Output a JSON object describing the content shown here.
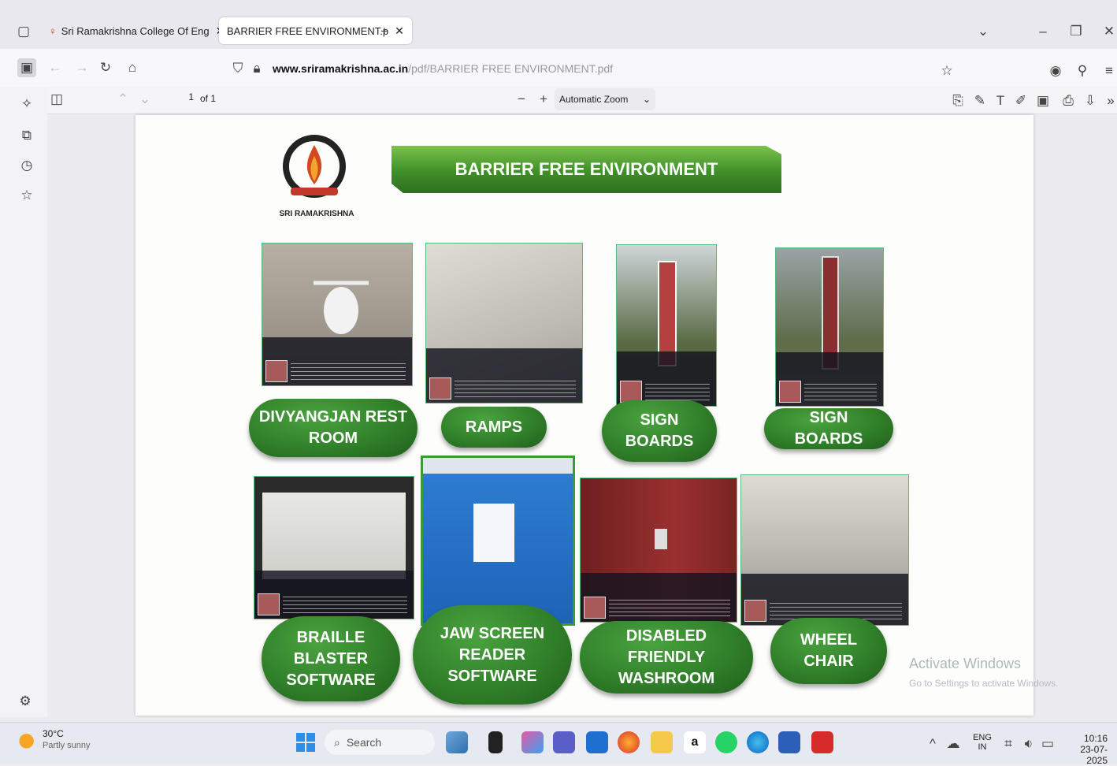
{
  "tabs": [
    {
      "label": "Sri Ramakrishna College Of Eng"
    },
    {
      "label": "BARRIER FREE ENVIRONMENT.p"
    }
  ],
  "address": {
    "domain": "www.sriramakrishna.ac.in",
    "path": "/pdf/BARRIER FREE ENVIRONMENT.pdf"
  },
  "pdf_toolbar": {
    "page_number": "1",
    "page_total": "of 1",
    "zoom": "Automatic Zoom"
  },
  "document": {
    "banner": "BARRIER FREE ENVIRONMENT",
    "logo_text": "SRI RAMAKRISHNA",
    "items": [
      {
        "label": "DIVYANGJAN REST\nROOM"
      },
      {
        "label": "RAMPS"
      },
      {
        "label": "SIGN\nBOARDS"
      },
      {
        "label": "SIGN\nBOARDS"
      },
      {
        "label": "BRAILLE\nBLASTER\nSOFTWARE"
      },
      {
        "label": "JAW SCREEN\nREADER\nSOFTWARE"
      },
      {
        "label": "DISABLED\nFRIENDLY\nWASHROOM"
      },
      {
        "label": "WHEEL\nCHAIR"
      }
    ]
  },
  "watermark": {
    "line1": "Activate Windows",
    "line2": "Go to Settings to activate Windows."
  },
  "taskbar": {
    "weather_temp": "30°C",
    "weather_desc": "Partly sunny",
    "search_label": "Search",
    "lang_primary": "ENG",
    "lang_secondary": "IN",
    "time": "10:16",
    "date": "23-07-2025"
  },
  "colors": {
    "accent_green": "#2f7d28",
    "banner_green": "#4e9e33"
  }
}
